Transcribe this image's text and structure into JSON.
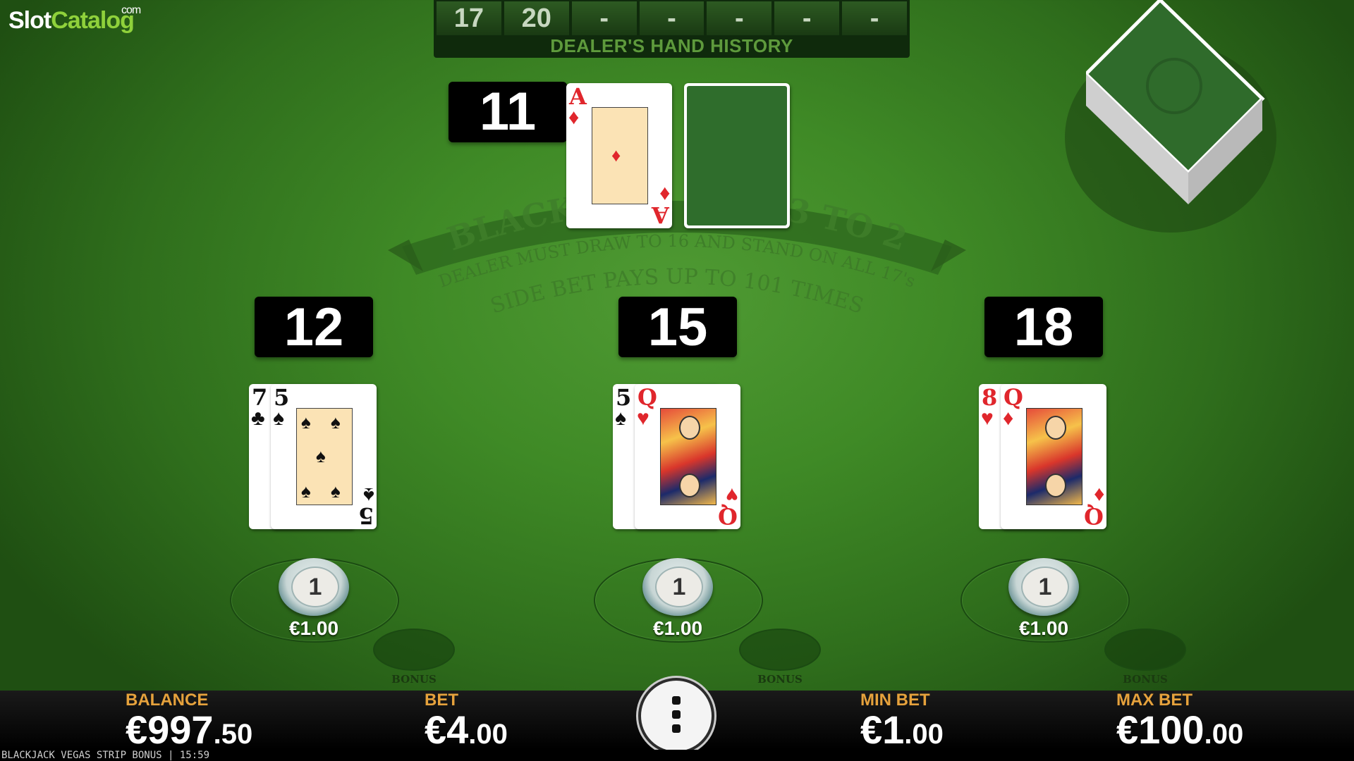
{
  "logo": {
    "part1": "Slot",
    "part2": "Catalog",
    "suffix": "com"
  },
  "dealer_history": {
    "values": [
      "17",
      "20",
      "-",
      "-",
      "-",
      "-",
      "-"
    ],
    "label": "DEALER'S HAND HISTORY"
  },
  "table_text": {
    "line1": "BLACKJACK PAYS 3 TO 2",
    "line2": "DEALER MUST DRAW TO 16 AND STAND ON ALL 17's",
    "line3": "SIDE BET PAYS UP TO 101 TIMES"
  },
  "dealer": {
    "score": "11",
    "cards": [
      {
        "rank": "A",
        "suit": "♦",
        "color": "red"
      },
      {
        "face_down": true
      }
    ]
  },
  "hands": [
    {
      "score": "12",
      "cards": [
        {
          "rank": "7",
          "suit": "♣",
          "color": "black"
        },
        {
          "rank": "5",
          "suit": "♠",
          "color": "black"
        }
      ],
      "chip_value": "1",
      "bet": "€1.00",
      "bonus_label": "BONUS"
    },
    {
      "score": "15",
      "cards": [
        {
          "rank": "5",
          "suit": "♠",
          "color": "black"
        },
        {
          "rank": "Q",
          "suit": "♥",
          "color": "red"
        }
      ],
      "chip_value": "1",
      "bet": "€1.00",
      "bonus_label": "BONUS"
    },
    {
      "score": "18",
      "cards": [
        {
          "rank": "8",
          "suit": "♥",
          "color": "red"
        },
        {
          "rank": "Q",
          "suit": "♦",
          "color": "red"
        }
      ],
      "chip_value": "1",
      "bet": "€1.00",
      "bonus_label": "BONUS"
    }
  ],
  "bottom_bar": {
    "balance": {
      "label": "BALANCE",
      "main": "€997",
      "cents": ".50"
    },
    "bet": {
      "label": "BET",
      "main": "€4",
      "cents": ".00"
    },
    "min_bet": {
      "label": "MIN BET",
      "main": "€1",
      "cents": ".00"
    },
    "max_bet": {
      "label": "MAX BET",
      "main": "€100",
      "cents": ".00"
    },
    "menu_icon": "vertical-dots-icon"
  },
  "info_line": "BLACKJACK VEGAS STRIP BONUS | 15:59",
  "colors": {
    "felt": "#3f8a26",
    "accent": "#e6a23c",
    "red_suit": "#e0262c"
  }
}
